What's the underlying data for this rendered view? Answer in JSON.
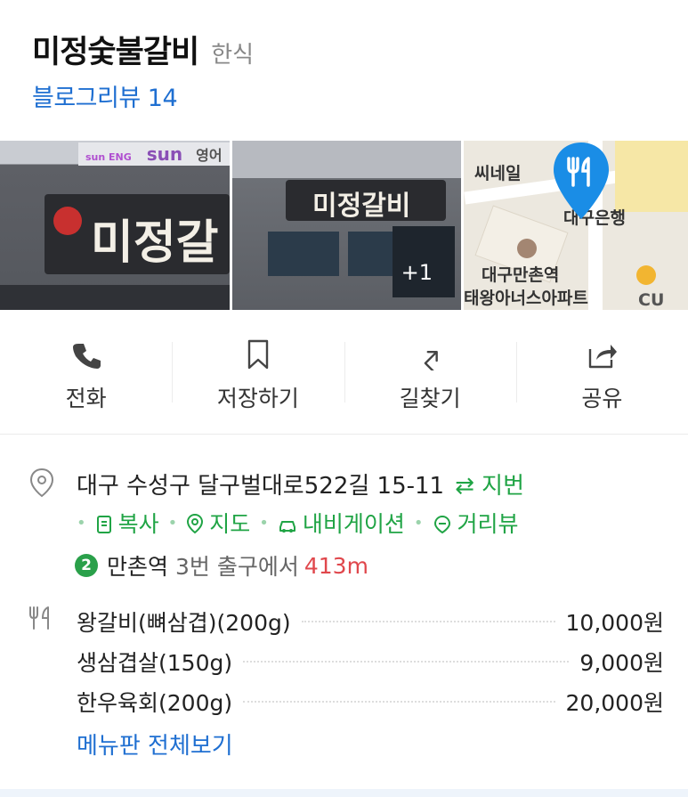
{
  "place": {
    "name": "미정숯불갈비",
    "category": "한식",
    "blog_review": "블로그리뷰 14"
  },
  "photos": {
    "more_count": "+1",
    "storefront_sign": "미정갈",
    "storefront_sign2": "미정갈비",
    "building_signs": [
      "sun ENG",
      "sun",
      "영어"
    ],
    "map_labels": {
      "nail": "씨네일",
      "bank": "대구은행",
      "station": "대구만촌역",
      "apartment": "태왕아너스아파트",
      "store": "CU"
    }
  },
  "actions": [
    {
      "label": "전화",
      "icon": "phone-icon"
    },
    {
      "label": "저장하기",
      "icon": "bookmark-icon"
    },
    {
      "label": "길찾기",
      "icon": "directions-icon"
    },
    {
      "label": "공유",
      "icon": "share-icon"
    }
  ],
  "address": {
    "text": "대구 수성구 달구벌대로522길 15-11",
    "jibun": "⇄ 지번",
    "links": [
      "복사",
      "지도",
      "내비게이션",
      "거리뷰"
    ]
  },
  "subway": {
    "line": "2",
    "station": "만촌역",
    "exit": "3번 출구에서",
    "distance": "413m"
  },
  "menu": {
    "items": [
      {
        "name": "왕갈비(뼈삼겹)(200g)",
        "price": "10,000원"
      },
      {
        "name": "생삼겹살(150g)",
        "price": "9,000원"
      },
      {
        "name": "한우육회(200g)",
        "price": "20,000원"
      }
    ],
    "more_label": "메뉴판 전체보기"
  },
  "colors": {
    "link_blue": "#1f6fd1",
    "green": "#20a445",
    "distance_red": "#e0474c",
    "line2_green": "#2aa04a",
    "map_pin_blue": "#1a8de6"
  }
}
